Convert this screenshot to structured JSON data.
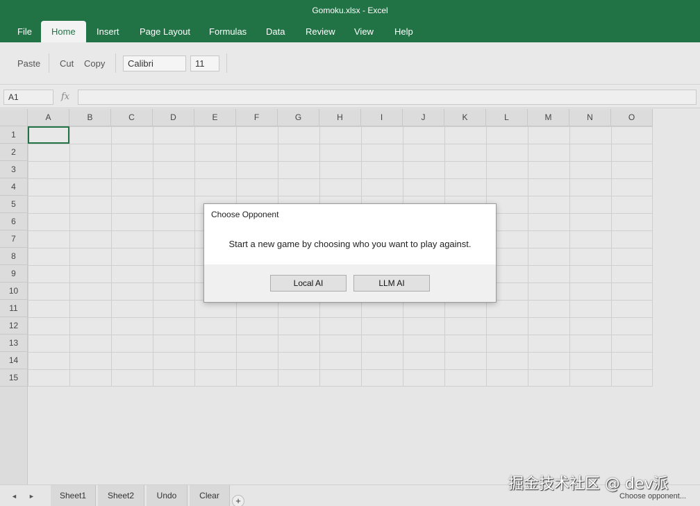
{
  "window": {
    "title": "Gomoku.xlsx - Excel"
  },
  "ribbon_tabs": [
    "File",
    "Home",
    "Insert",
    "Page Layout",
    "Formulas",
    "Data",
    "Review",
    "View",
    "Help"
  ],
  "active_tab": "Home",
  "ribbon": {
    "paste": "Paste",
    "cut": "Cut",
    "copy": "Copy",
    "font_name": "Calibri",
    "font_size": "11"
  },
  "formula_bar": {
    "name_box": "A1",
    "fx": "fx",
    "value": ""
  },
  "columns": [
    "A",
    "B",
    "C",
    "D",
    "E",
    "F",
    "G",
    "H",
    "I",
    "J",
    "K",
    "L",
    "M",
    "N",
    "O"
  ],
  "rows": [
    "1",
    "2",
    "3",
    "4",
    "5",
    "6",
    "7",
    "8",
    "9",
    "10",
    "11",
    "12",
    "13",
    "14",
    "15"
  ],
  "selected_cell": "A1",
  "dialog": {
    "title": "Choose Opponent",
    "message": "Start a new game by choosing who you want to play against.",
    "buttons": [
      "Local AI",
      "LLM AI"
    ]
  },
  "sheet_nav": {
    "prev": "◄",
    "next": "►",
    "add": "+"
  },
  "sheet_tabs": [
    "Sheet1",
    "Sheet2",
    "Undo",
    "Clear"
  ],
  "status_text": "Choose opponent...",
  "watermark": "掘金技术社区 @ dev派",
  "colors": {
    "accent": "#217346",
    "grid_line": "#cfcfcf",
    "header_bg": "#dcdcdc"
  }
}
